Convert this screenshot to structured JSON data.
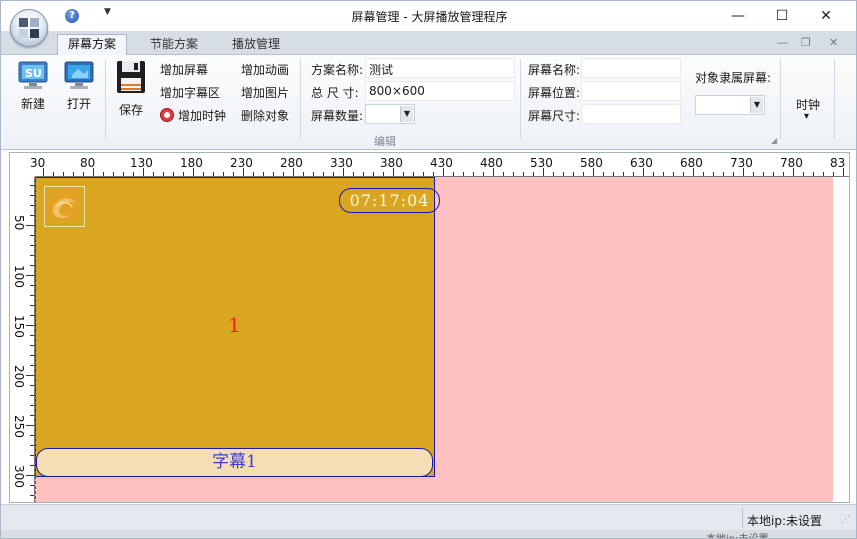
{
  "window": {
    "title": "屏幕管理 - 大屏播放管理程序",
    "qa_help": "?",
    "qa_dropdown": "▼",
    "minimize": "—",
    "maximize": "☐",
    "close": "✕"
  },
  "ribbon_tabs": [
    {
      "label": "屏幕方案",
      "active": true
    },
    {
      "label": "节能方案",
      "active": false
    },
    {
      "label": "播放管理",
      "active": false
    }
  ],
  "mdi": {
    "minimize": "—",
    "restore": "❐",
    "close": "✕"
  },
  "ribbon": {
    "new_label": "新建",
    "open_label": "打开",
    "save_label": "保存",
    "add_screen": "增加屏幕",
    "add_caption_area": "增加字幕区",
    "add_clock": "增加时钟",
    "add_animation": "增加动画",
    "add_image": "增加图片",
    "delete_object": "删除对象",
    "scheme_name_label": "方案名称:",
    "scheme_name_value": "测试",
    "total_size_label": "总  尺 寸:",
    "total_size_value": "800×600",
    "screen_count_label": "屏幕数量:",
    "screen_name_label": "屏幕名称:",
    "screen_position_label": "屏幕位置:",
    "screen_size_label": "屏幕尺寸:",
    "owner_screen_label": "对象隶属屏幕:",
    "clock_label": "时钟",
    "clock_arrow": "▾",
    "group_edit": "编辑",
    "launcher": "◢"
  },
  "ruler": {
    "h_labels": [
      "30",
      "80",
      "130",
      "180",
      "230",
      "280",
      "330",
      "380",
      "430",
      "480",
      "530",
      "580",
      "630",
      "680",
      "730",
      "780",
      "83"
    ],
    "v_labels": [
      "50",
      "100",
      "150",
      "200",
      "250",
      "300"
    ]
  },
  "canvas": {
    "screen_number": "1",
    "clock_time": "07:17:04",
    "caption_text": "字幕1",
    "colors": {
      "background": "#ffc0c0",
      "screen": "#daa520",
      "caption": "#f5deb3",
      "border": "#1b1baa",
      "number": "#ff1a1a"
    }
  },
  "statusbar": {
    "local_ip": "本地ip:未设置",
    "grip": "⋰",
    "ghost_text": "本地ip:未设置"
  }
}
